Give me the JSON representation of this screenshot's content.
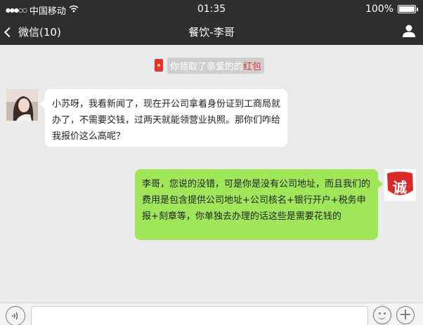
{
  "status_bar": {
    "signal": "●●●○○",
    "carrier": "中国移动",
    "time": "01:35",
    "battery_text": "100%",
    "battery_level": 1.0
  },
  "nav": {
    "back_label": "微信(10)",
    "title": "餐饮-李哥"
  },
  "system_message": {
    "text": "你领取了亲爱的的",
    "link": "红包"
  },
  "messages": [
    {
      "side": "left",
      "text": "小苏呀，我看新闻了，现在开公司拿着身份证到工商局就办了，不需要交钱，过两天就能领营业执照。那你们咋给我报价这么高呢？"
    },
    {
      "side": "right",
      "text": "李哥，您说的没错，可是你是没有公司地址，而且我们的费用是包含提供公司地址+公司核名+银行开户+税务申报+刻章等，你单独去办理的话这些是需要花钱的",
      "avatar_text": "诚"
    }
  ],
  "colors": {
    "bar_bg": "#2e2e2e",
    "chat_bg": "#ebebeb",
    "sent_bubble": "#9fe658",
    "received_bubble": "#ffffff",
    "red_packet": "#e4322c"
  }
}
